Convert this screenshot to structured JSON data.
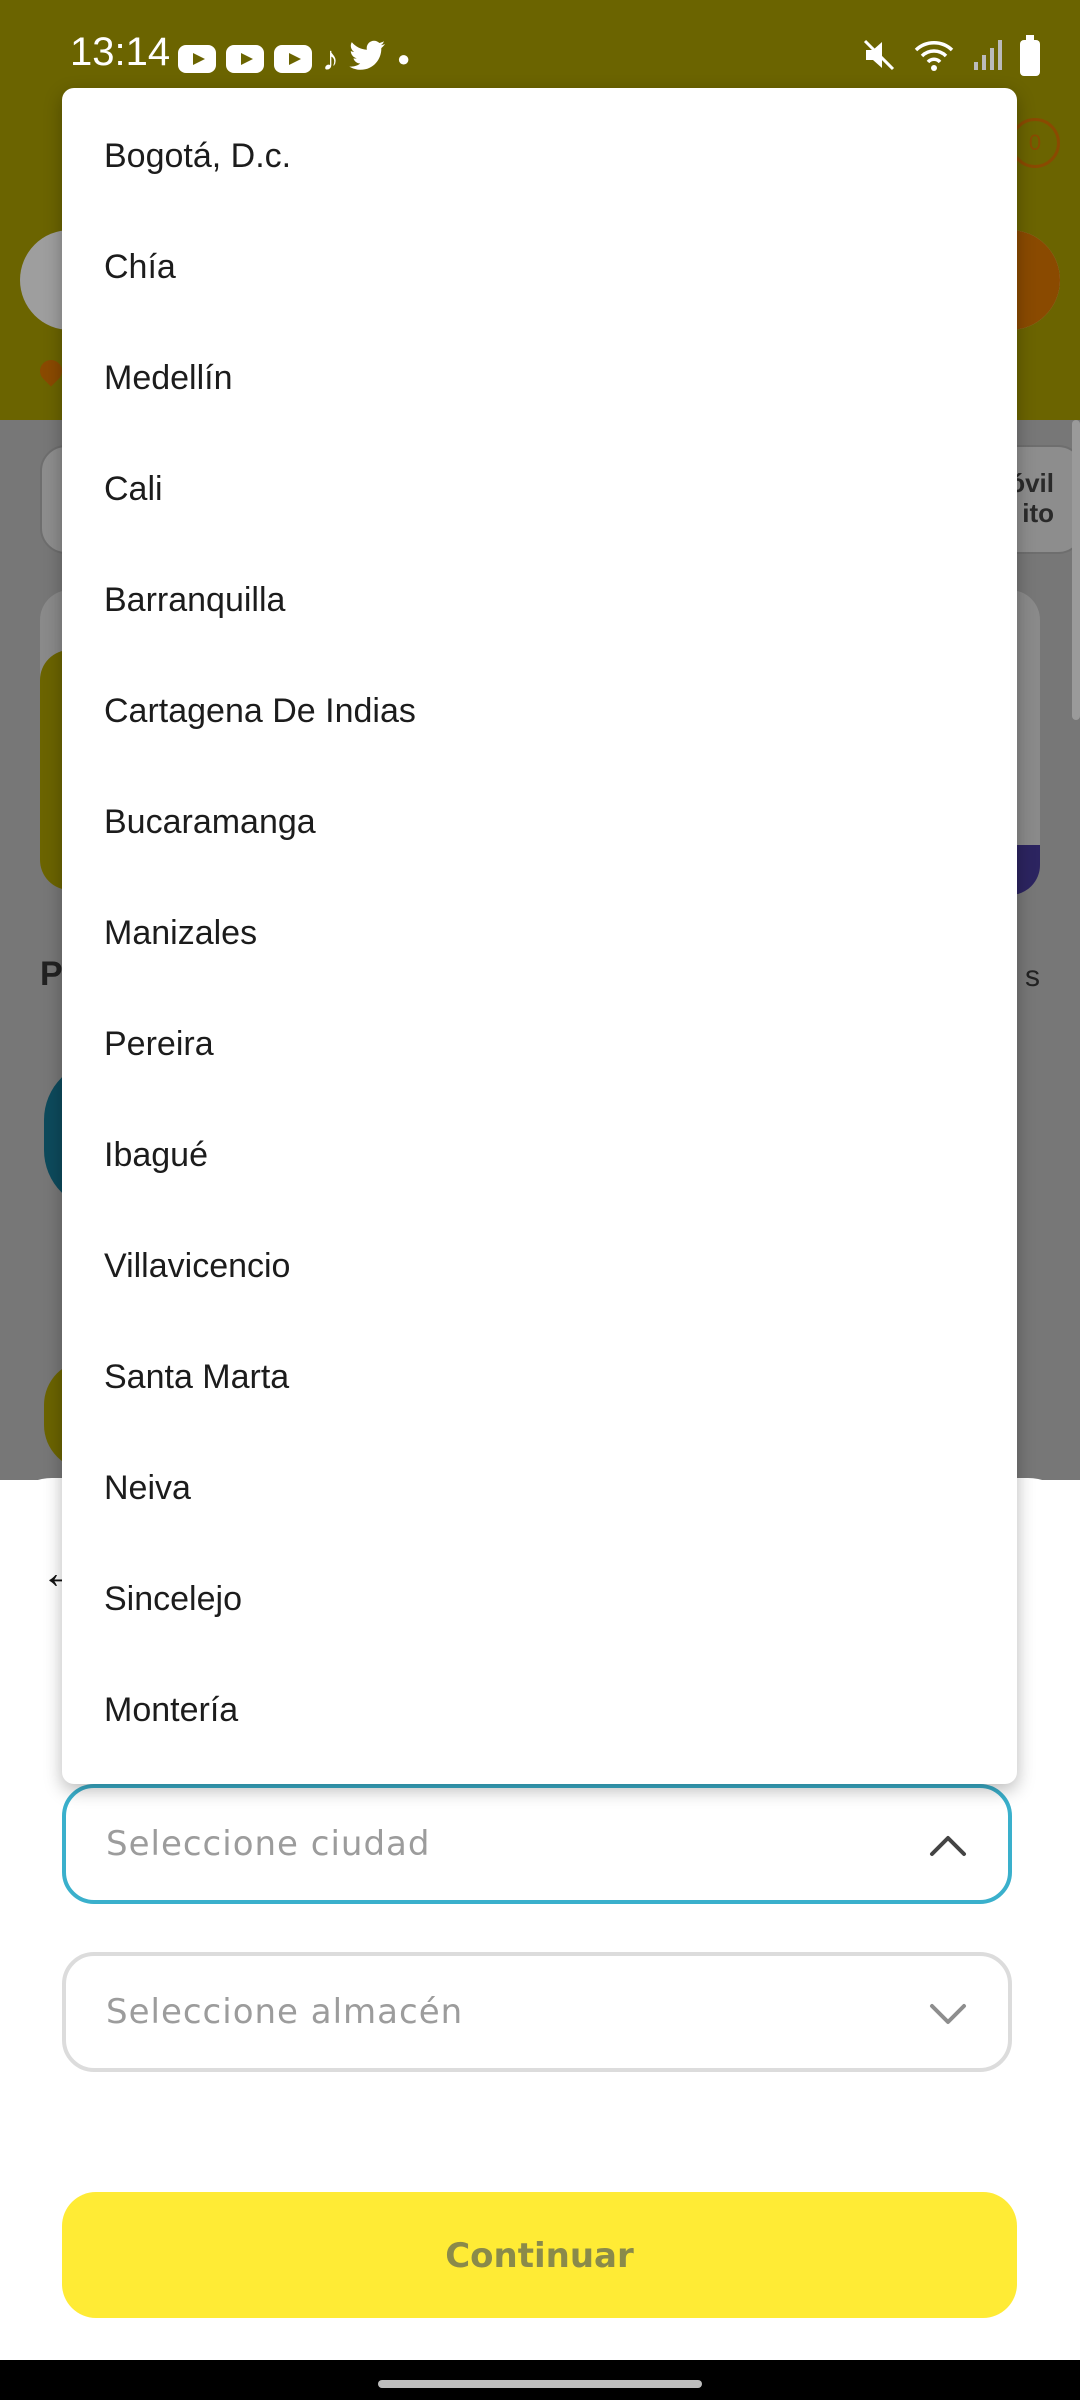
{
  "status_bar": {
    "time": "13:14",
    "notification_icons": [
      "youtube-icon",
      "youtube-icon",
      "youtube-icon",
      "tiktok-icon",
      "twitter-icon",
      "dot-icon"
    ],
    "system_icons": [
      "mute-icon",
      "wifi-icon",
      "signal-icon",
      "battery-icon"
    ]
  },
  "background": {
    "cart_badge": "0",
    "card_text_line1": "óvil",
    "card_text_line2": "ito",
    "section_heading": "P",
    "section_link": "s"
  },
  "city_dropdown": {
    "options": [
      "Bogotá, D.c.",
      "Chía",
      "Medellín",
      "Cali",
      "Barranquilla",
      "Cartagena De Indias",
      "Bucaramanga",
      "Manizales",
      "Pereira",
      "Ibagué",
      "Villavicencio",
      "Santa Marta",
      "Neiva",
      "Sincelejo",
      "Montería"
    ]
  },
  "sheet": {
    "city_placeholder": "Seleccione ciudad",
    "store_placeholder": "Seleccione almacén",
    "continue_label": "Continuar"
  },
  "colors": {
    "header": "#6b6400",
    "focus_border": "#3ab0cc",
    "button": "#ffeb35",
    "button_text": "#8a8a4a"
  }
}
